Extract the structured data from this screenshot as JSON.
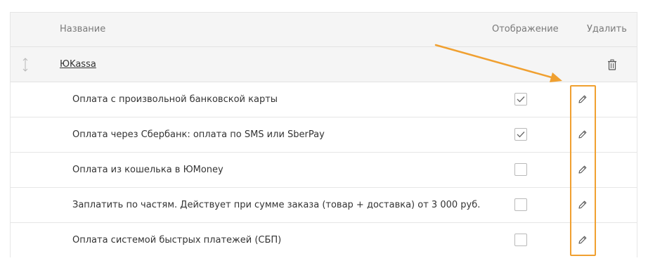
{
  "header": {
    "name": "Название",
    "display": "Отображение",
    "delete": "Удалить"
  },
  "group": {
    "name": "ЮKassa"
  },
  "methods": [
    {
      "label": "Оплата с произвольной банковской карты",
      "enabled": true
    },
    {
      "label": "Оплата через Сбербанк: оплата по SMS или SberPay",
      "enabled": true
    },
    {
      "label": "Оплата из кошелька в ЮMoney",
      "enabled": false
    },
    {
      "label": "Заплатить по частям. Действует при сумме заказа (товар + доставка) от 3 000 руб.",
      "enabled": false
    },
    {
      "label": "Оплата системой быстрых платежей (СБП)",
      "enabled": false
    }
  ],
  "icons": {
    "drag": "drag-handle-icon",
    "trash": "trash-icon",
    "edit": "pencil-icon",
    "check": "checkmark-icon"
  },
  "colors": {
    "highlight": "#f0a030",
    "header_bg": "#f5f5f5",
    "border": "#e6e6e6"
  }
}
